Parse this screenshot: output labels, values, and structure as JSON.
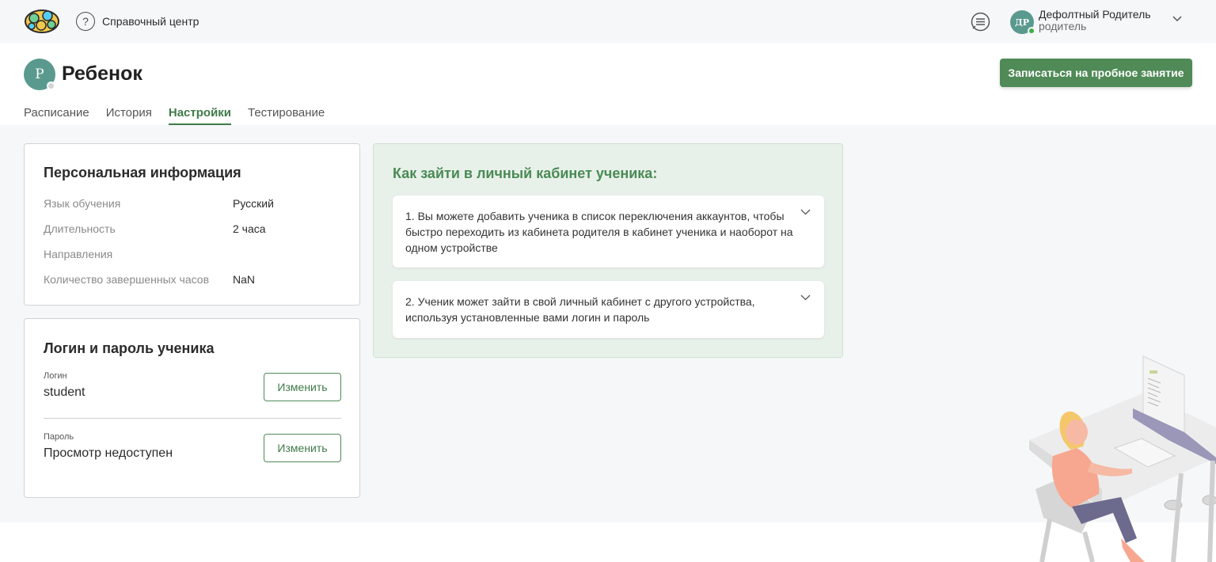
{
  "topbar": {
    "help_label": "Справочный центр",
    "help_symbol": "?",
    "user_initials": "ДР",
    "user_name": "Дефолтный Родитель",
    "user_role": "родитель"
  },
  "header": {
    "child_initial": "Р",
    "child_name": "Ребенок",
    "trial_button": "Записаться на пробное занятие",
    "tabs": [
      {
        "label": "Расписание",
        "active": false
      },
      {
        "label": "История",
        "active": false
      },
      {
        "label": "Настройки",
        "active": true
      },
      {
        "label": "Тестирование",
        "active": false
      }
    ]
  },
  "personal": {
    "title": "Персональная информация",
    "rows": [
      {
        "label": "Язык обучения",
        "value": "Русский"
      },
      {
        "label": "Длительность",
        "value": "2 часа"
      },
      {
        "label": "Направления",
        "value": ""
      },
      {
        "label": "Количество завершенных часов",
        "value": "NaN"
      }
    ]
  },
  "credentials": {
    "title": "Логин и пароль ученика",
    "login_label": "Логин",
    "login_value": "student",
    "password_label": "Пароль",
    "password_value": "Просмотр недоступен",
    "change_label": "Изменить"
  },
  "howto": {
    "title": "Как зайти в личный кабинет ученика:",
    "items": [
      {
        "text": "1. Вы можете добавить ученика в список переключения аккаунтов, чтобы быстро переходить из кабинета родителя в кабинет ученика и наоборот на одном устройстве"
      },
      {
        "text": "2. Ученик может зайти в свой личный кабинет с другого устройства, используя установленные вами логин и пароль"
      }
    ]
  },
  "colors": {
    "accent": "#4f8a57",
    "avatar": "#5a9a8e",
    "background": "#f6f7f9",
    "howto_bg": "#e8f1e9"
  },
  "icons": [
    "brain-logo-icon",
    "help-circle-icon",
    "chat-icon",
    "chevron-down-icon",
    "online-dot-icon"
  ]
}
